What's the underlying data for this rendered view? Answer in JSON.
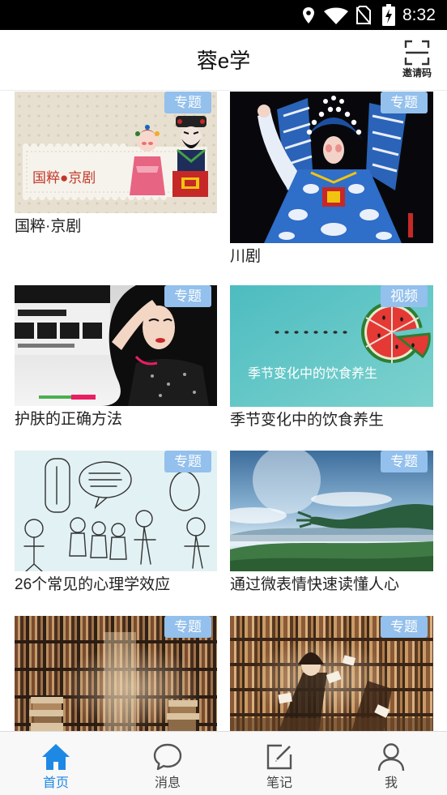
{
  "status_bar": {
    "time": "8:32",
    "icons": [
      "location-icon",
      "wifi-icon",
      "no-sim-icon",
      "battery-charging-icon"
    ]
  },
  "header": {
    "title": "蓉e学",
    "invite_label": "邀请码",
    "invite_icon": "scan-icon"
  },
  "cards": [
    {
      "title": "国粹·京剧",
      "badge": "专题",
      "image_text": "国粹●京剧"
    },
    {
      "title": "川剧",
      "badge": "专题"
    },
    {
      "title": "护肤的正确方法",
      "badge": "专题"
    },
    {
      "title": "季节变化中的饮食养生",
      "badge": "视频",
      "image_text": "季节变化中的饮食养生"
    },
    {
      "title": "26个常见的心理学效应",
      "badge": "专题"
    },
    {
      "title": "通过微表情快速读懂人心",
      "badge": "专题"
    },
    {
      "badge": "专题"
    },
    {
      "badge": "专题"
    }
  ],
  "tabs": [
    {
      "label": "首页",
      "icon": "home-icon",
      "active": true
    },
    {
      "label": "消息",
      "icon": "chat-icon",
      "active": false
    },
    {
      "label": "笔记",
      "icon": "note-edit-icon",
      "active": false
    },
    {
      "label": "我",
      "icon": "user-icon",
      "active": false
    }
  ],
  "colors": {
    "accent": "#1e88e5",
    "badge": "#93c0ec",
    "status_bar": "#000000"
  }
}
